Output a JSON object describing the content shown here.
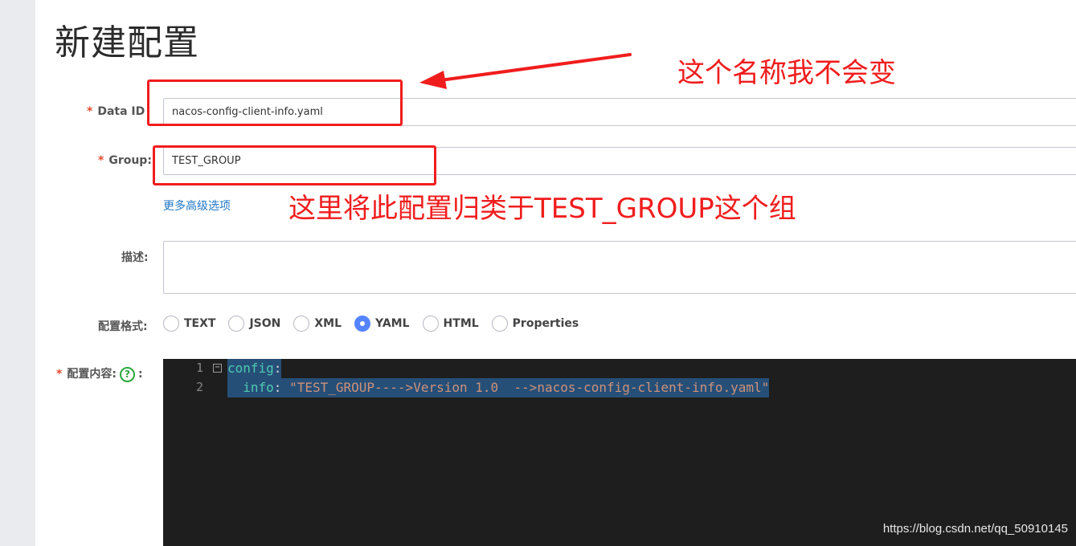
{
  "page": {
    "title": "新建配置"
  },
  "form": {
    "data_id": {
      "required_mark": "*",
      "label": "Data ID",
      "value": "nacos-config-client-info.yaml"
    },
    "group": {
      "required_mark": "*",
      "label": "Group:",
      "value": "TEST_GROUP"
    },
    "advanced_link": "更多高级选项",
    "description": {
      "label": "描述:",
      "value": ""
    },
    "format": {
      "label": "配置格式:",
      "options": [
        "TEXT",
        "JSON",
        "XML",
        "YAML",
        "HTML",
        "Properties"
      ],
      "selected": "YAML"
    },
    "content": {
      "required_mark": "*",
      "label": "配置内容:",
      "help_glyph": "?",
      "colon": ":"
    }
  },
  "editor": {
    "line_numbers": [
      "1",
      "2"
    ],
    "fold_glyph": "−",
    "lines": [
      {
        "key": "config",
        "sep": ":"
      },
      {
        "indent": "  ",
        "key": "info",
        "sep": ": ",
        "string": "\"TEST_GROUP---->Version 1.0  -->nacos-config-client-info.yaml\""
      }
    ]
  },
  "annotations": {
    "data_id_note": "这个名称我不会变",
    "group_note": "这里将此配置归类于TEST_GROUP这个组",
    "color": "#f01d1d"
  },
  "watermark": "https://blog.csdn.net/qq_50910145",
  "colors": {
    "accent": "#5584ff",
    "link": "#2077c6",
    "required": "#e34a2d",
    "editor_bg": "#1e1e1e"
  }
}
